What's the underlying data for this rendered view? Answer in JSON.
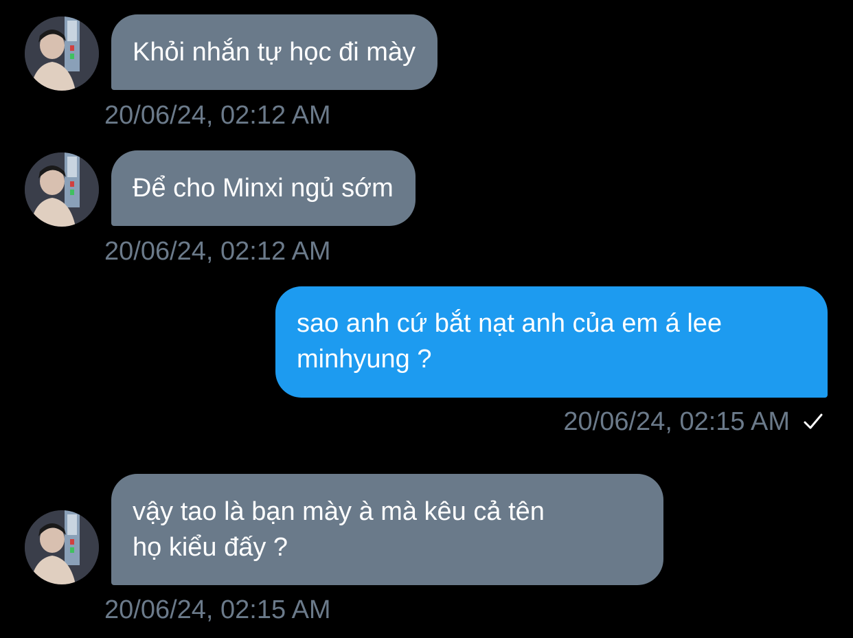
{
  "colors": {
    "background": "#000000",
    "incoming_bubble": "#6a7a8a",
    "outgoing_bubble": "#1d9bf0",
    "timestamp": "#6b7a8a"
  },
  "messages": [
    {
      "direction": "incoming",
      "lines": [
        "Khỏi nhắn tự học đi mày"
      ],
      "timestamp": "20/06/24, 02:12 AM",
      "avatar": "user-avatar"
    },
    {
      "direction": "incoming",
      "lines": [
        "Để cho Minxi ngủ sớm"
      ],
      "timestamp": "20/06/24, 02:12 AM",
      "avatar": "user-avatar"
    },
    {
      "direction": "outgoing",
      "lines": [
        "sao anh cứ bắt nạt anh của em á lee",
        "minhyung ?"
      ],
      "timestamp": "20/06/24, 02:15 AM",
      "status_icon": "checkmark-icon"
    },
    {
      "direction": "incoming",
      "lines": [
        "vậy tao là bạn mày à mà kêu cả tên",
        "họ kiểu đấy ?"
      ],
      "timestamp": "20/06/24, 02:15 AM",
      "avatar": "user-avatar"
    }
  ]
}
